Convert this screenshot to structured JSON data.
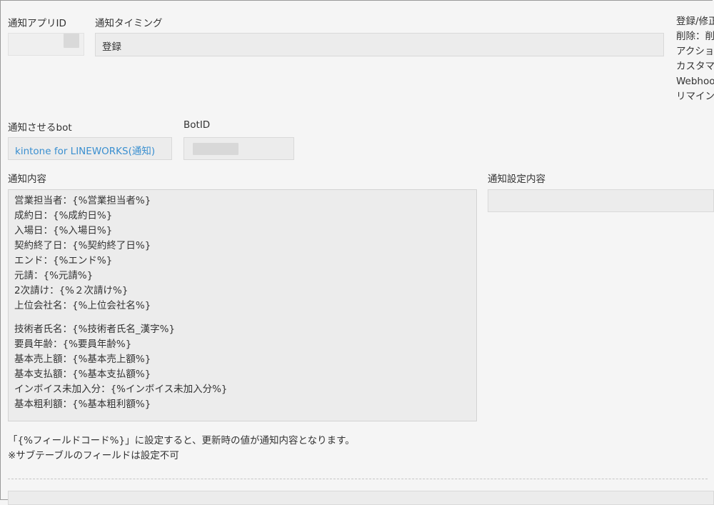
{
  "app_id": {
    "label": "通知アプリID",
    "value": ""
  },
  "timing": {
    "label": "通知タイミング",
    "value": "登録"
  },
  "side_options": [
    "登録/修正",
    "削除：削",
    "アクショ",
    "カスタマ",
    "Webhoo",
    "リマイン"
  ],
  "bot": {
    "label": "通知させるbot",
    "value": "kintone for LINEWORKS(通知)"
  },
  "bot_id": {
    "label": "BotID",
    "value": ""
  },
  "content": {
    "label": "通知内容",
    "lines_group1": [
      "営業担当者：{%営業担当者%}",
      "成約日：{%成約日%}",
      "入場日：{%入場日%}",
      "契約終了日：{%契約終了日%}",
      "エンド：{%エンド%}",
      "元請：{%元請%}",
      "2次請け：{%２次請け%}",
      "上位会社名：{%上位会社名%}"
    ],
    "lines_group2": [
      "技術者氏名：{%技術者氏名_漢字%}",
      "要員年齢：{%要員年齢%}",
      "基本売上額：{%基本売上額%}",
      "基本支払額：{%基本支払額%}",
      "インボイス未加入分：{%インボイス未加入分%}",
      "基本粗利額：{%基本粗利額%}"
    ]
  },
  "settings": {
    "label": "通知設定内容",
    "value": ""
  },
  "notes": {
    "line1": "「{%フィールドコード%}」に設定すると、更新時の値が通知内容となります。",
    "line2": "※サブテーブルのフィールドは設定不可"
  }
}
